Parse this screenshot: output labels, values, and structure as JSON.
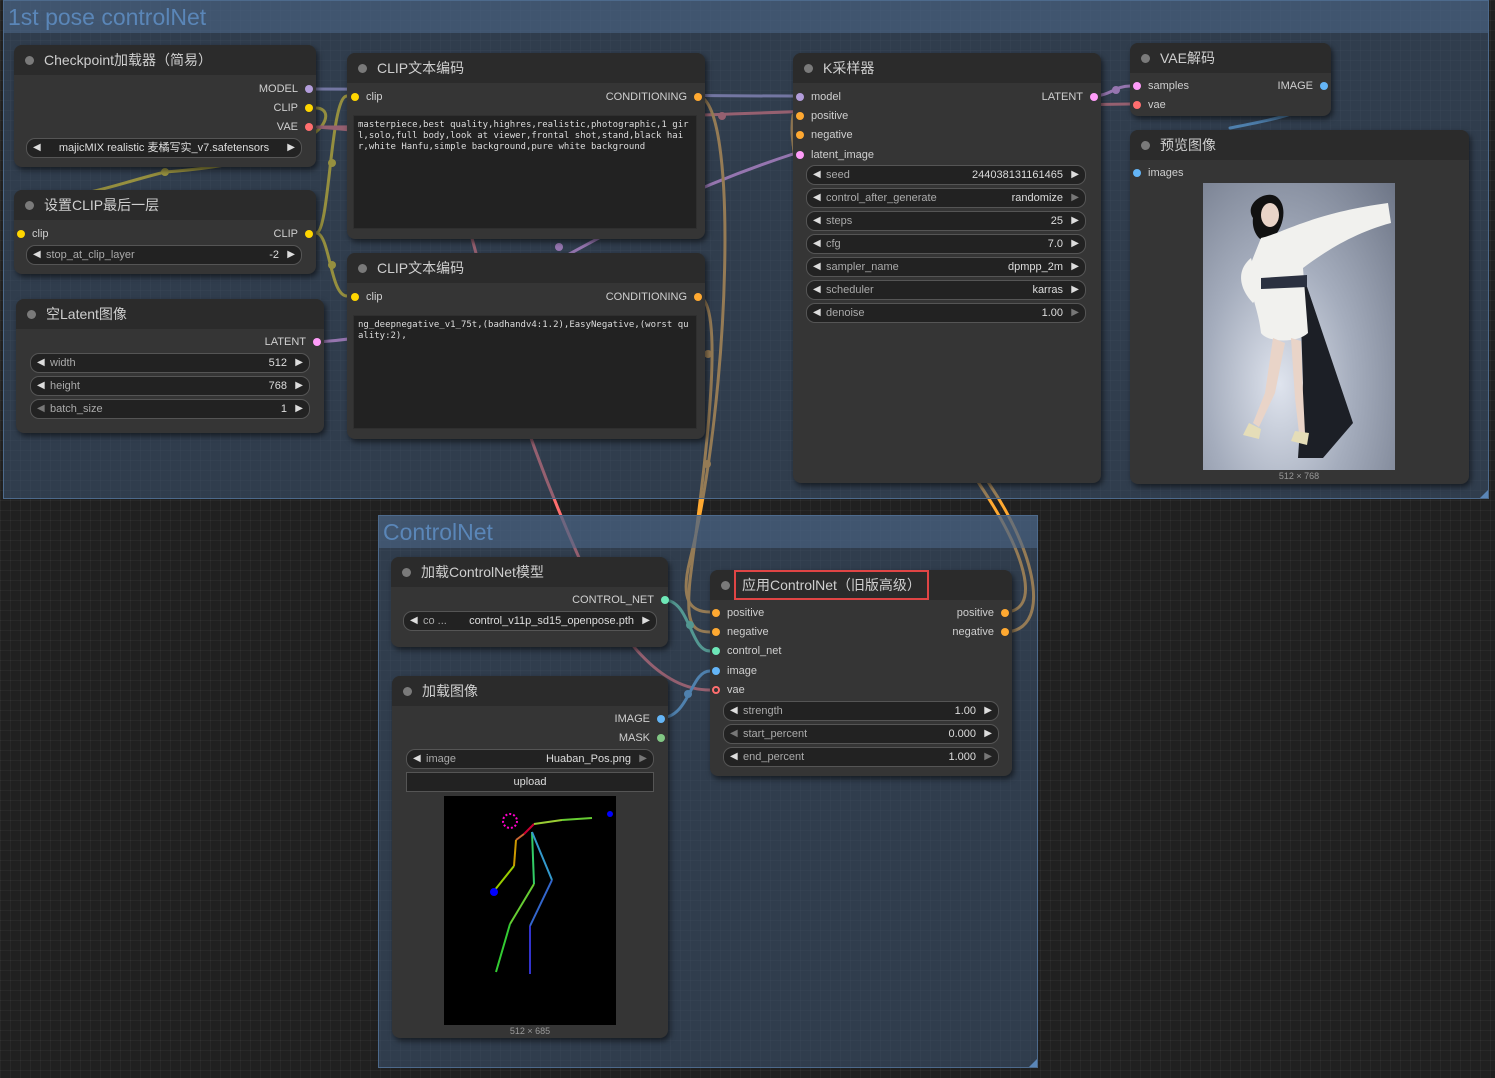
{
  "colors": {
    "model": "#b39ddb",
    "clip": "#ffd600",
    "vae": "#ff6e6e",
    "conditioning": "#ffa931",
    "latent": "#ff9cf9",
    "image": "#64b5f6",
    "control_net": "#6ee7b7",
    "mask": "#81c784"
  },
  "groups": {
    "pose": {
      "title": "1st pose controlNet"
    },
    "controlnet": {
      "title": "ControlNet"
    }
  },
  "checkpoint": {
    "title": "Checkpoint加载器（简易）",
    "outputs": [
      "MODEL",
      "CLIP",
      "VAE"
    ],
    "ckpt_name": "majicMIX realistic 麦橘写实_v7.safetensors"
  },
  "clip_set_last": {
    "title": "设置CLIP最后一层",
    "input": "clip",
    "output": "CLIP",
    "widget_label": "stop_at_clip_layer",
    "widget_value": "-2"
  },
  "empty_latent": {
    "title": "空Latent图像",
    "output": "LATENT",
    "widgets": [
      {
        "label": "width",
        "value": "512"
      },
      {
        "label": "height",
        "value": "768"
      },
      {
        "label": "batch_size",
        "value": "1"
      }
    ]
  },
  "clip_pos": {
    "title": "CLIP文本编码",
    "input": "clip",
    "output": "CONDITIONING",
    "text": "masterpiece,best quality,highres,realistic,photographic,1 girl,solo,full body,look at viewer,frontal shot,stand,black hair,white Hanfu,simple background,pure white background"
  },
  "clip_neg": {
    "title": "CLIP文本编码",
    "input": "clip",
    "output": "CONDITIONING",
    "text": "ng_deepnegative_v1_75t,(badhandv4:1.2),EasyNegative,(worst quality:2),"
  },
  "ksampler": {
    "title": "K采样器",
    "inputs": [
      "model",
      "positive",
      "negative",
      "latent_image"
    ],
    "output": "LATENT",
    "widgets": [
      {
        "label": "seed",
        "value": "244038131161465"
      },
      {
        "label": "control_after_generate",
        "value": "randomize"
      },
      {
        "label": "steps",
        "value": "25"
      },
      {
        "label": "cfg",
        "value": "7.0"
      },
      {
        "label": "sampler_name",
        "value": "dpmpp_2m"
      },
      {
        "label": "scheduler",
        "value": "karras"
      },
      {
        "label": "denoise",
        "value": "1.00"
      }
    ]
  },
  "vae_decode": {
    "title": "VAE解码",
    "inputs": [
      "samples",
      "vae"
    ],
    "output": "IMAGE"
  },
  "preview": {
    "title": "预览图像",
    "input": "images",
    "caption": "512 × 768"
  },
  "cn_loader": {
    "title": "加载ControlNet模型",
    "output": "CONTROL_NET",
    "prefix": "co ...",
    "value": "control_v11p_sd15_openpose.pth"
  },
  "load_image": {
    "title": "加载图像",
    "outputs": [
      "IMAGE",
      "MASK"
    ],
    "widget_label": "image",
    "widget_value": "Huaban_Pos.png",
    "upload_label": "upload",
    "caption": "512 × 685"
  },
  "apply_cn": {
    "title": "应用ControlNet（旧版高级）",
    "inputs": [
      "positive",
      "negative",
      "control_net",
      "image",
      "vae"
    ],
    "outputs": [
      "positive",
      "negative"
    ],
    "widgets": [
      {
        "label": "strength",
        "value": "1.00"
      },
      {
        "label": "start_percent",
        "value": "0.000"
      },
      {
        "label": "end_percent",
        "value": "1.000"
      }
    ]
  }
}
